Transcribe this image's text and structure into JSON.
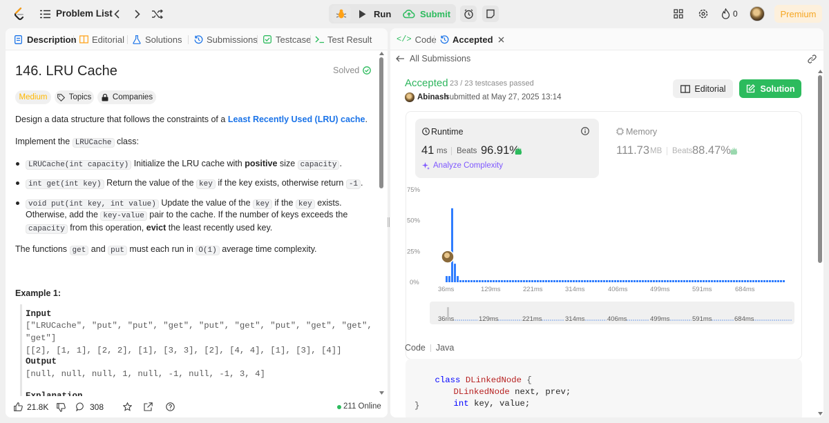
{
  "topbar": {
    "problem_list": "Problem List",
    "run": "Run",
    "submit": "Submit",
    "fire_count": "0",
    "premium": "Premium"
  },
  "left": {
    "tabs": {
      "description": "Description",
      "editorial": "Editorial",
      "solutions": "Solutions",
      "submissions": "Submissions",
      "testcase": "Testcase",
      "test_result": "Test Result"
    },
    "title": "146. LRU Cache",
    "solved": "Solved",
    "difficulty": "Medium",
    "topics": "Topics",
    "companies": "Companies",
    "p1_pre": "Design a data structure that follows the constraints of a ",
    "p1_link": "Least Recently Used (LRU) cache",
    "p1_post": ".",
    "p2_pre": "Implement the ",
    "p2_code": "LRUCache",
    "p2_post": " class:",
    "b1_code": "LRUCache(int capacity)",
    "b1_t1": " Initialize the LRU cache with ",
    "b1_bold": "positive",
    "b1_t2": " size ",
    "b1_code2": "capacity",
    "b1_t3": ".",
    "b2_code": "int get(int key)",
    "b2_t1": " Return the value of the ",
    "b2_code2": "key",
    "b2_t2": " if the key exists, otherwise return ",
    "b2_code3": "-1",
    "b2_t3": ".",
    "b3_code": "void put(int key, int value)",
    "b3_t1": " Update the value of the ",
    "b3_code2": "key",
    "b3_t2": " if the ",
    "b3_code3": "key",
    "b3_t3": " exists.",
    "b3_l2_t1": "Otherwise, add the ",
    "b3_l2_code": "key-value",
    "b3_l2_t2": " pair to the cache. If the number of keys exceeds the",
    "b3_l3_code": "capacity",
    "b3_l3_t1": " from this operation, ",
    "b3_l3_bold": "evict",
    "b3_l3_t2": " the least recently used key.",
    "p3_t1": "The functions ",
    "p3_code1": "get",
    "p3_t2": " and ",
    "p3_code2": "put",
    "p3_t3": " must each run in ",
    "p3_code3": "O(1)",
    "p3_t4": " average time complexity.",
    "example_title": "Example 1:",
    "input_label": "Input",
    "input_l1": "[\"LRUCache\", \"put\", \"put\", \"get\", \"put\", \"get\", \"put\", \"get\", \"get\",",
    "input_l2": "\"get\"]",
    "input_l3": "[[2], [1, 1], [2, 2], [1], [3, 3], [2], [4, 4], [1], [3], [4]]",
    "output_label": "Output",
    "output_l1": "[null, null, null, 1, null, -1, null, -1, 3, 4]",
    "explanation_partial": "Explanation",
    "likes": "21.8K",
    "comments": "308",
    "online": "211 Online"
  },
  "right": {
    "tabs": {
      "code": "Code",
      "accepted": "Accepted"
    },
    "all_submissions": "All Submissions",
    "status": "Accepted",
    "testcases": "23 / 23 testcases passed",
    "user": "Abinash",
    "submitted_at": "submitted at May 27, 2025 13:14",
    "editorial_btn": "Editorial",
    "solution_btn": "Solution",
    "runtime_label": "Runtime",
    "runtime_value": "41",
    "runtime_unit": "ms",
    "beats_label": "Beats",
    "runtime_beats": "96.91%",
    "analyze": "Analyze Complexity",
    "memory_label": "Memory",
    "memory_value": "111.73",
    "memory_unit": "MB",
    "memory_beats": "88.47%",
    "code_label": "Code",
    "lang": "Java",
    "code_l1_kw": "class",
    "code_l1_name": "DLinkedNode",
    "code_l1_brace": "{",
    "code_l2_type": "DLinkedNode",
    "code_l2_rest": "next, prev;",
    "code_l3_type": "int",
    "code_l3_rest": "key, value;",
    "code_l4": "}"
  },
  "chart_data": {
    "type": "bar",
    "y_ticks": [
      "75%",
      "50%",
      "25%",
      "0%"
    ],
    "x_ticks": [
      "36ms",
      "129ms",
      "221ms",
      "314ms",
      "406ms",
      "499ms",
      "591ms",
      "684ms"
    ],
    "ylim": [
      0,
      75
    ],
    "series": [
      {
        "values": [
          5,
          5,
          60,
          15,
          5,
          1
        ]
      }
    ],
    "user_runtime_ms": 41
  },
  "colors": {
    "accent_green": "#2cbb5d",
    "accepted": "#2db55d",
    "link_blue": "#1a73e8",
    "bar_blue": "#2f7dff",
    "medium": "#ffb800",
    "premium": "#f5a623"
  }
}
